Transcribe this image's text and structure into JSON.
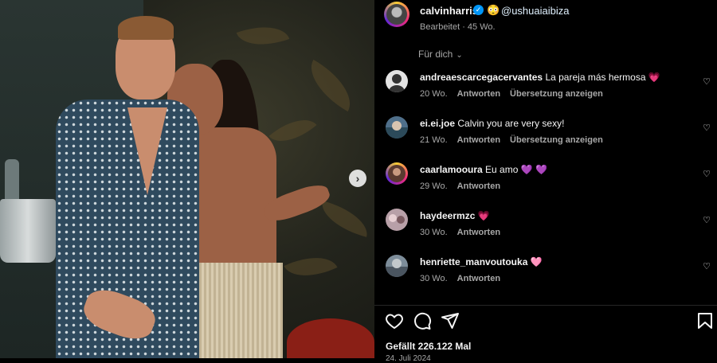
{
  "post": {
    "username": "calvinharris",
    "verified": true,
    "emoji": "😳",
    "mention": "@ushuaiaibiza",
    "subtitle": "Bearbeitet · 45 Wo."
  },
  "sort": {
    "label": "Für dich"
  },
  "comments": [
    {
      "user": "andreaescarcegacervantes",
      "text": "La pareja más hermosa 💗",
      "age": "20 Wo.",
      "reply": "Antworten",
      "translate": "Übersetzung anzeigen",
      "avatar_color": "#d8d8d8"
    },
    {
      "user": "ei.ei.joe",
      "text": "Calvin you are very sexy!",
      "age": "21 Wo.",
      "reply": "Antworten",
      "translate": "Übersetzung anzeigen",
      "avatar_color": "#6c8fa6"
    },
    {
      "user": "caarlamooura",
      "text": "Eu amo 💜 💜",
      "age": "29 Wo.",
      "reply": "Antworten",
      "translate": "",
      "avatar_color": "#7a4a3c"
    },
    {
      "user": "haydeermzc",
      "text": "💗",
      "age": "30 Wo.",
      "reply": "Antworten",
      "translate": "",
      "avatar_color": "#c9a9b5"
    },
    {
      "user": "henriette_manvoutouka",
      "text": "🩷",
      "age": "30 Wo.",
      "reply": "Antworten",
      "translate": "",
      "avatar_color": "#8a9aa8"
    }
  ],
  "footer": {
    "likes": "Gefällt 226.122 Mal",
    "date": "24. Juli 2024"
  },
  "colors": {
    "accent": "#0095f6",
    "muted": "#a8a8a8",
    "text": "#f5f5f5"
  }
}
